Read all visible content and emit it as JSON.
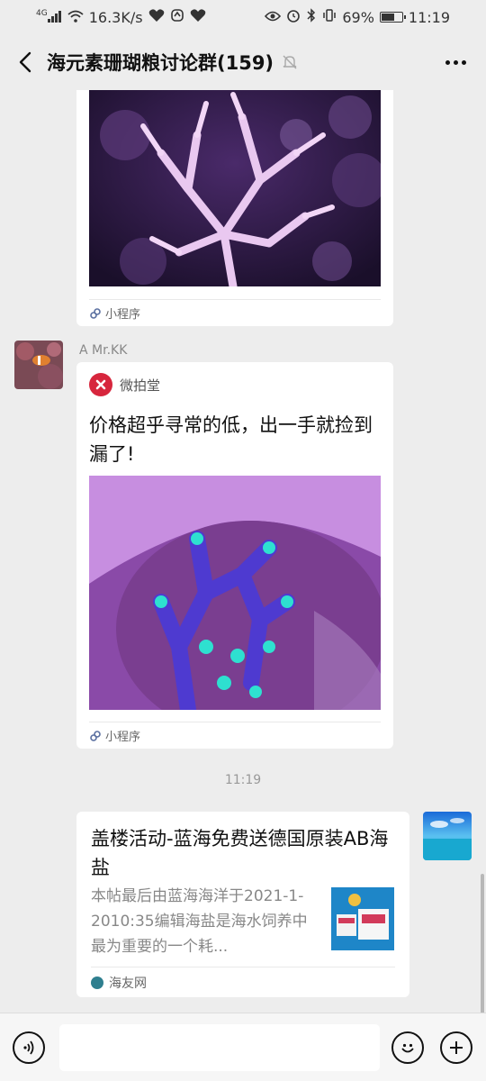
{
  "status_bar": {
    "network": "4G",
    "speed": "16.3K/s",
    "battery_pct": "69%",
    "battery_level": 0.69,
    "time": "11:19"
  },
  "nav": {
    "title": "海元素珊瑚粮讨论群(159)"
  },
  "messages": {
    "m1": {
      "footer_label": "小程序"
    },
    "m2": {
      "sender": "A  Mr.KK",
      "source_name": "微拍堂",
      "title": "价格超乎寻常的低，出一手就捡到漏了!",
      "footer_label": "小程序"
    },
    "timestamp": "11:19",
    "m3": {
      "title": "盖楼活动-蓝海免费送德国原装AB海盐",
      "description": "本帖最后由蓝海海洋于2021-1-2010:35编辑海盐是海水饲养中最为重要的一个耗...",
      "source_name": "海友网"
    }
  },
  "colors": {
    "background": "#ededed",
    "card": "#ffffff",
    "brand_red": "#d7263d"
  },
  "icons": [
    "back-arrow-icon",
    "mute-bell-icon",
    "more-icon",
    "miniprogram-icon",
    "voice-icon",
    "emoji-icon",
    "plus-icon"
  ]
}
